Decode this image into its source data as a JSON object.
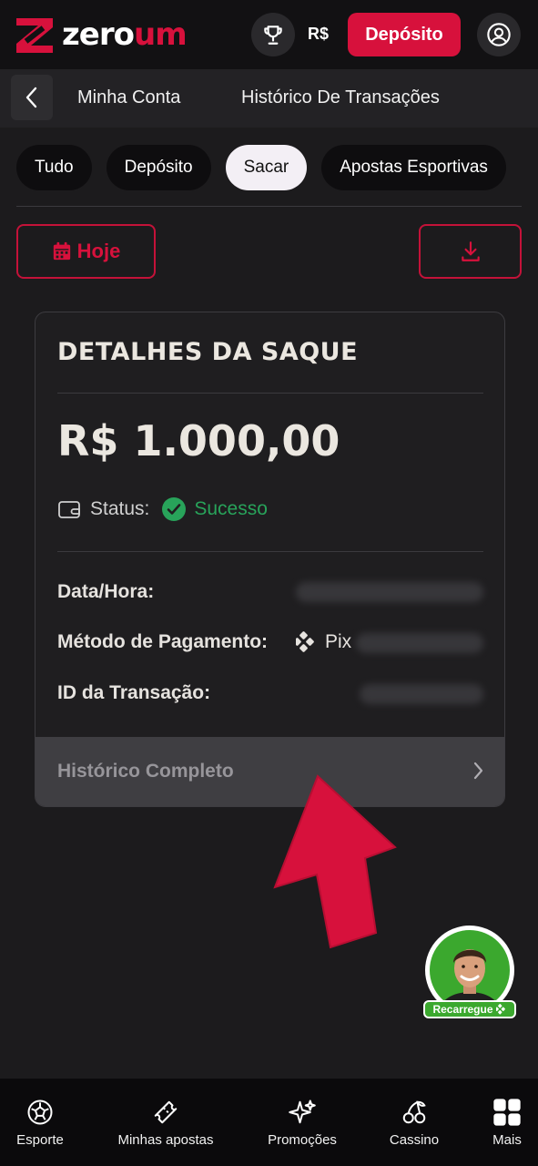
{
  "header": {
    "logo_text": "zeroum",
    "currency": "R$",
    "deposit_label": "Depósito"
  },
  "breadcrumb": {
    "account": "Minha Conta",
    "current": "Histórico De Transações"
  },
  "filters": {
    "tabs": [
      {
        "label": "Tudo",
        "active": false
      },
      {
        "label": "Depósito",
        "active": false
      },
      {
        "label": "Sacar",
        "active": true
      },
      {
        "label": "Apostas Esportivas",
        "active": false
      }
    ],
    "date_label": "Hoje"
  },
  "details": {
    "title": "DETALHES DA SAQUE",
    "amount": "R$ 1.000,00",
    "status_label": "Status:",
    "status_value": "Sucesso",
    "date_label": "Data/Hora:",
    "method_label": "Método de Pagamento:",
    "method_value": "Pix",
    "txid_label": "ID da Transação:",
    "history_label": "Histórico Completo"
  },
  "promo": {
    "badge": "Recarregue"
  },
  "bottom_nav": [
    {
      "label": "Esporte",
      "icon": "soccer-ball-icon"
    },
    {
      "label": "Minhas apostas",
      "icon": "ticket-icon"
    },
    {
      "label": "Promoções",
      "icon": "sparkles-icon"
    },
    {
      "label": "Cassino",
      "icon": "cherries-icon"
    },
    {
      "label": "Mais",
      "icon": "grid-icon"
    }
  ],
  "colors": {
    "accent": "#d7113c",
    "success": "#28a35a",
    "background": "#1c1b1d",
    "header": "#121113"
  }
}
